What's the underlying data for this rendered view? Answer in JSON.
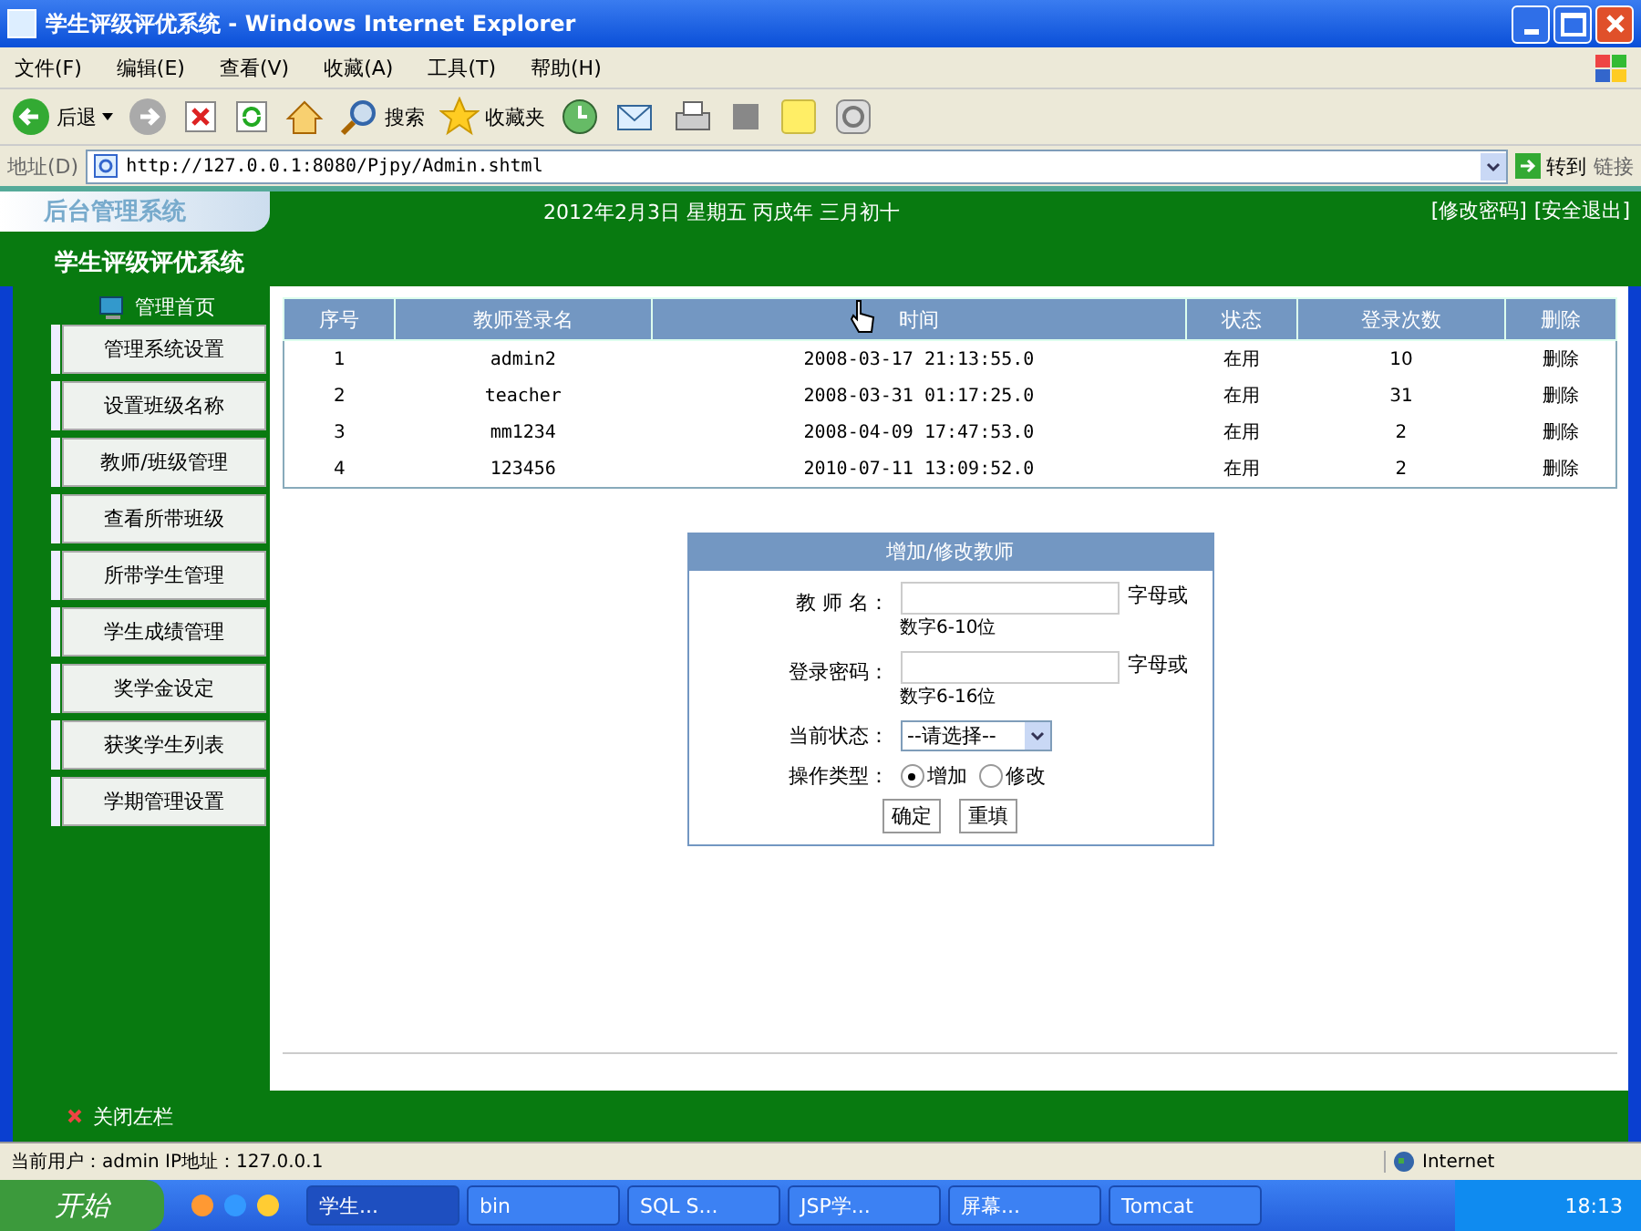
{
  "window": {
    "title": "学生评级评优系统 - Windows Internet Explorer"
  },
  "menu": [
    "文件(F)",
    "编辑(E)",
    "查看(V)",
    "收藏(A)",
    "工具(T)",
    "帮助(H)"
  ],
  "toolbar": {
    "back": "后退",
    "search": "搜索",
    "favorites": "收藏夹"
  },
  "address": {
    "label": "地址(D)",
    "url": "http://127.0.0.1:8080/Pjpy/Admin.shtml",
    "go": "转到",
    "links": "链接"
  },
  "header": {
    "logo": "后台管理系统",
    "title": "学生评级评优系统",
    "date": "2012年2月3日  星期五  丙戌年  三月初十",
    "links": [
      "[修改密码]",
      "[安全退出]"
    ]
  },
  "sidebar": {
    "home": "管理首页",
    "items": [
      "管理系统设置",
      "设置班级名称",
      "教师/班级管理",
      "查看所带班级",
      "所带学生管理",
      "学生成绩管理",
      "奖学金设定",
      "获奖学生列表",
      "学期管理设置"
    ],
    "close": "关闭左栏"
  },
  "table": {
    "columns": [
      "序号",
      "教师登录名",
      "时间",
      "状态",
      "登录次数",
      "删除"
    ],
    "rows": [
      [
        "1",
        "admin2",
        "2008-03-17 21:13:55.0",
        "在用",
        "10",
        "删除"
      ],
      [
        "2",
        "teacher",
        "2008-03-31 01:17:25.0",
        "在用",
        "31",
        "删除"
      ],
      [
        "3",
        "mm1234",
        "2008-04-09 17:47:53.0",
        "在用",
        "2",
        "删除"
      ],
      [
        "4",
        "123456",
        "2010-07-11 13:09:52.0",
        "在用",
        "2",
        "删除"
      ]
    ]
  },
  "form": {
    "title": "增加/修改教师",
    "fields": [
      {
        "label": "教 师 名：",
        "hint_1": "字母或",
        "hint_2": "数字6-10位"
      },
      {
        "label": "登录密码：",
        "hint_1": "字母或",
        "hint_2": "数字6-16位"
      }
    ],
    "status": {
      "label": "当前状态：",
      "value": "--请选择--"
    },
    "type": {
      "label": "操作类型：",
      "options": [
        {
          "label": "增加",
          "selected": true
        },
        {
          "label": "修改",
          "selected": false
        }
      ]
    },
    "buttons": [
      "确定",
      "重填"
    ]
  },
  "status_bar": {
    "user": "当前用户：admin  IP地址：127.0.0.1",
    "zone": "Internet"
  },
  "taskbar": {
    "start": "开始",
    "tasks": [
      {
        "label": "学生...",
        "selected": true
      },
      {
        "label": "bin",
        "selected": false
      },
      {
        "label": "SQL S...",
        "selected": false
      },
      {
        "label": "JSP学...",
        "selected": false
      },
      {
        "label": "屏幕...",
        "selected": false
      },
      {
        "label": "Tomcat",
        "selected": false
      }
    ],
    "clock": "18:13"
  }
}
